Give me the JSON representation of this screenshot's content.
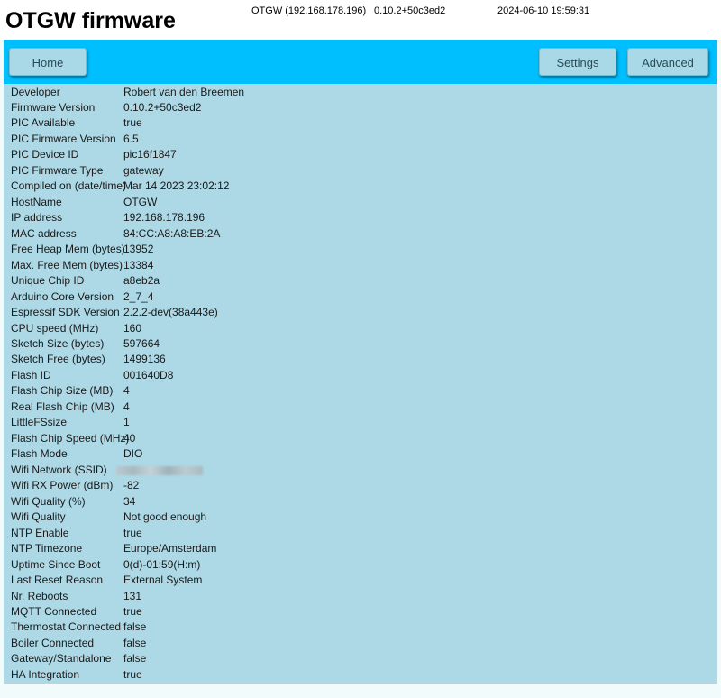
{
  "header": {
    "title": "OTGW firmware",
    "host": "OTGW (192.168.178.196)",
    "version": "0.10.2+50c3ed2",
    "datetime": "2024-06-10 19:59:31"
  },
  "nav": {
    "home": "Home",
    "settings": "Settings",
    "advanced": "Advanced"
  },
  "rows": [
    {
      "label": "Developer",
      "value": "Robert van den Breemen"
    },
    {
      "label": "Firmware Version",
      "value": "0.10.2+50c3ed2"
    },
    {
      "label": "PIC Available",
      "value": "true"
    },
    {
      "label": "PIC Firmware Version",
      "value": "6.5"
    },
    {
      "label": "PIC Device ID",
      "value": "pic16f1847"
    },
    {
      "label": "PIC Firmware Type",
      "value": "gateway"
    },
    {
      "label": "Compiled on (date/time)",
      "value": "Mar 14 2023 23:02:12"
    },
    {
      "label": "HostName",
      "value": "OTGW"
    },
    {
      "label": "IP address",
      "value": "192.168.178.196"
    },
    {
      "label": "MAC address",
      "value": "84:CC:A8:A8:EB:2A"
    },
    {
      "label": "Free Heap Mem (bytes)",
      "value": "13952"
    },
    {
      "label": "Max. Free Mem (bytes)",
      "value": "13384"
    },
    {
      "label": "Unique Chip ID",
      "value": "a8eb2a"
    },
    {
      "label": "Arduino Core Version",
      "value": "2_7_4"
    },
    {
      "label": "Espressif SDK Version",
      "value": "2.2.2-dev(38a443e)"
    },
    {
      "label": "CPU speed (MHz)",
      "value": "160"
    },
    {
      "label": "Sketch Size (bytes)",
      "value": "597664"
    },
    {
      "label": "Sketch Free (bytes)",
      "value": "1499136"
    },
    {
      "label": "Flash ID",
      "value": "001640D8"
    },
    {
      "label": "Flash Chip Size (MB)",
      "value": "4"
    },
    {
      "label": "Real Flash Chip (MB)",
      "value": "4"
    },
    {
      "label": "LittleFSsize",
      "value": "1"
    },
    {
      "label": "Flash Chip Speed (MHz)",
      "value": "40"
    },
    {
      "label": "Flash Mode",
      "value": "DIO"
    },
    {
      "label": "Wifi Network (SSID)",
      "value": ""
    },
    {
      "label": "Wifi RX Power (dBm)",
      "value": "-82"
    },
    {
      "label": "Wifi Quality (%)",
      "value": "34"
    },
    {
      "label": "Wifi Quality",
      "value": "Not good enough"
    },
    {
      "label": "NTP Enable",
      "value": "true"
    },
    {
      "label": "NTP Timezone",
      "value": "Europe/Amsterdam"
    },
    {
      "label": "Uptime Since Boot",
      "value": "0(d)-01:59(H:m)"
    },
    {
      "label": "Last Reset Reason",
      "value": "External System"
    },
    {
      "label": "Nr. Reboots",
      "value": "131"
    },
    {
      "label": "MQTT Connected",
      "value": "true"
    },
    {
      "label": "Thermostat Connected",
      "value": "false"
    },
    {
      "label": "Boiler Connected",
      "value": "false"
    },
    {
      "label": "Gateway/Standalone",
      "value": "false"
    },
    {
      "label": "HA Integration",
      "value": "true"
    }
  ]
}
